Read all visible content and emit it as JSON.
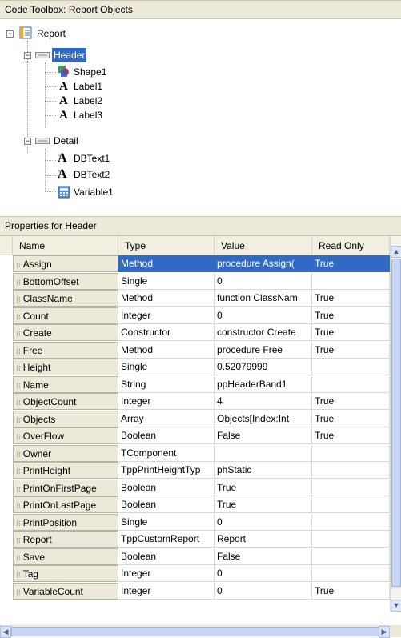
{
  "toolbox": {
    "title": "Code Toolbox: Report Objects",
    "tree": {
      "root": "Report",
      "header": "Header",
      "header_children": [
        "Shape1",
        "Label1",
        "Label2",
        "Label3"
      ],
      "detail": "Detail",
      "detail_children": [
        "DBText1",
        "DBText2",
        "Variable1"
      ]
    }
  },
  "properties": {
    "title": "Properties for Header",
    "columns": [
      "Name",
      "Type",
      "Value",
      "Read Only"
    ],
    "rows": [
      {
        "name": "Assign",
        "type": "Method",
        "value": "procedure Assign(",
        "readonly": "True"
      },
      {
        "name": "BottomOffset",
        "type": "Single",
        "value": "0",
        "readonly": ""
      },
      {
        "name": "ClassName",
        "type": "Method",
        "value": "function ClassNam",
        "readonly": "True"
      },
      {
        "name": "Count",
        "type": "Integer",
        "value": "0",
        "readonly": "True"
      },
      {
        "name": "Create",
        "type": "Constructor",
        "value": "constructor Create",
        "readonly": "True"
      },
      {
        "name": "Free",
        "type": "Method",
        "value": "procedure Free",
        "readonly": "True"
      },
      {
        "name": "Height",
        "type": "Single",
        "value": "0.52079999",
        "readonly": ""
      },
      {
        "name": "Name",
        "type": "String",
        "value": "ppHeaderBand1",
        "readonly": ""
      },
      {
        "name": "ObjectCount",
        "type": "Integer",
        "value": "4",
        "readonly": "True"
      },
      {
        "name": "Objects",
        "type": "Array",
        "value": "Objects[Index:Int",
        "readonly": "True"
      },
      {
        "name": "OverFlow",
        "type": "Boolean",
        "value": "False",
        "readonly": "True"
      },
      {
        "name": "Owner",
        "type": "TComponent",
        "value": "",
        "readonly": ""
      },
      {
        "name": "PrintHeight",
        "type": "TppPrintHeightTyp",
        "value": "phStatic",
        "readonly": ""
      },
      {
        "name": "PrintOnFirstPage",
        "type": "Boolean",
        "value": "True",
        "readonly": ""
      },
      {
        "name": "PrintOnLastPage",
        "type": "Boolean",
        "value": "True",
        "readonly": ""
      },
      {
        "name": "PrintPosition",
        "type": "Single",
        "value": "0",
        "readonly": ""
      },
      {
        "name": "Report",
        "type": "TppCustomReport",
        "value": "Report",
        "readonly": ""
      },
      {
        "name": "Save",
        "type": "Boolean",
        "value": "False",
        "readonly": ""
      },
      {
        "name": "Tag",
        "type": "Integer",
        "value": "0",
        "readonly": ""
      },
      {
        "name": "VariableCount",
        "type": "Integer",
        "value": "0",
        "readonly": "True"
      }
    ],
    "selected_row": 0
  },
  "colors": {
    "selection": "#316ac5",
    "panel": "#ece9d8"
  }
}
